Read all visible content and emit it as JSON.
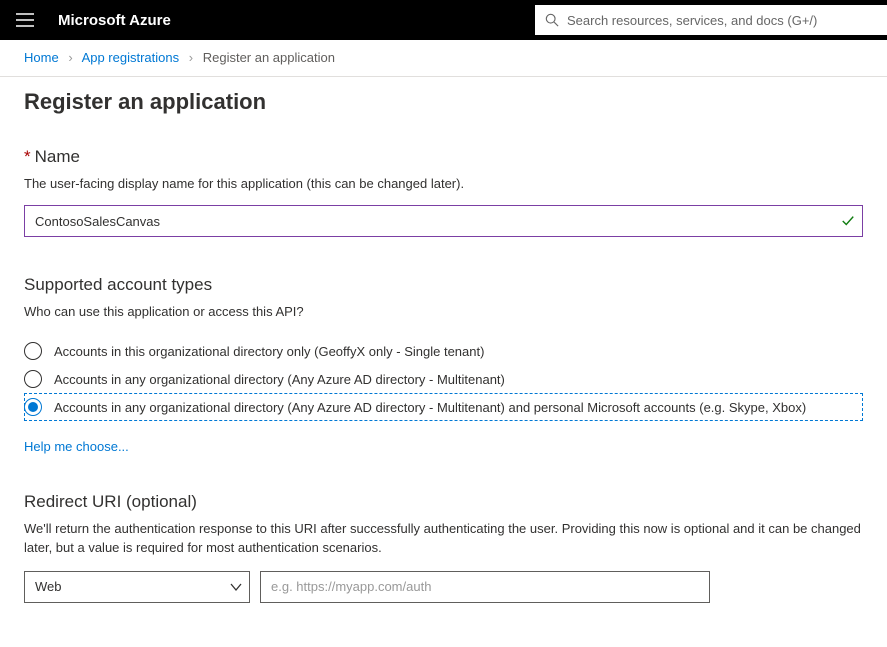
{
  "topbar": {
    "brand": "Microsoft Azure",
    "search_placeholder": "Search resources, services, and docs (G+/)"
  },
  "breadcrumb": {
    "items": [
      {
        "label": "Home",
        "link": true
      },
      {
        "label": "App registrations",
        "link": true
      },
      {
        "label": "Register an application",
        "link": false
      }
    ]
  },
  "page": {
    "title": "Register an application"
  },
  "name": {
    "heading": "Name",
    "required_mark": "*",
    "helper": "The user-facing display name for this application (this can be changed later).",
    "value": "ContosoSalesCanvas"
  },
  "account_types": {
    "heading": "Supported account types",
    "helper": "Who can use this application or access this API?",
    "options": [
      {
        "label": "Accounts in this organizational directory only (GeoffyX only - Single tenant)",
        "selected": false
      },
      {
        "label": "Accounts in any organizational directory (Any Azure AD directory - Multitenant)",
        "selected": false
      },
      {
        "label": "Accounts in any organizational directory (Any Azure AD directory - Multitenant) and personal Microsoft accounts (e.g. Skype, Xbox)",
        "selected": true
      }
    ],
    "help_link": "Help me choose..."
  },
  "redirect": {
    "heading": "Redirect URI (optional)",
    "helper": "We'll return the authentication response to this URI after successfully authenticating the user. Providing this now is optional and it can be changed later, but a value is required for most authentication scenarios.",
    "platform_value": "Web",
    "uri_placeholder": "e.g. https://myapp.com/auth",
    "uri_value": ""
  }
}
